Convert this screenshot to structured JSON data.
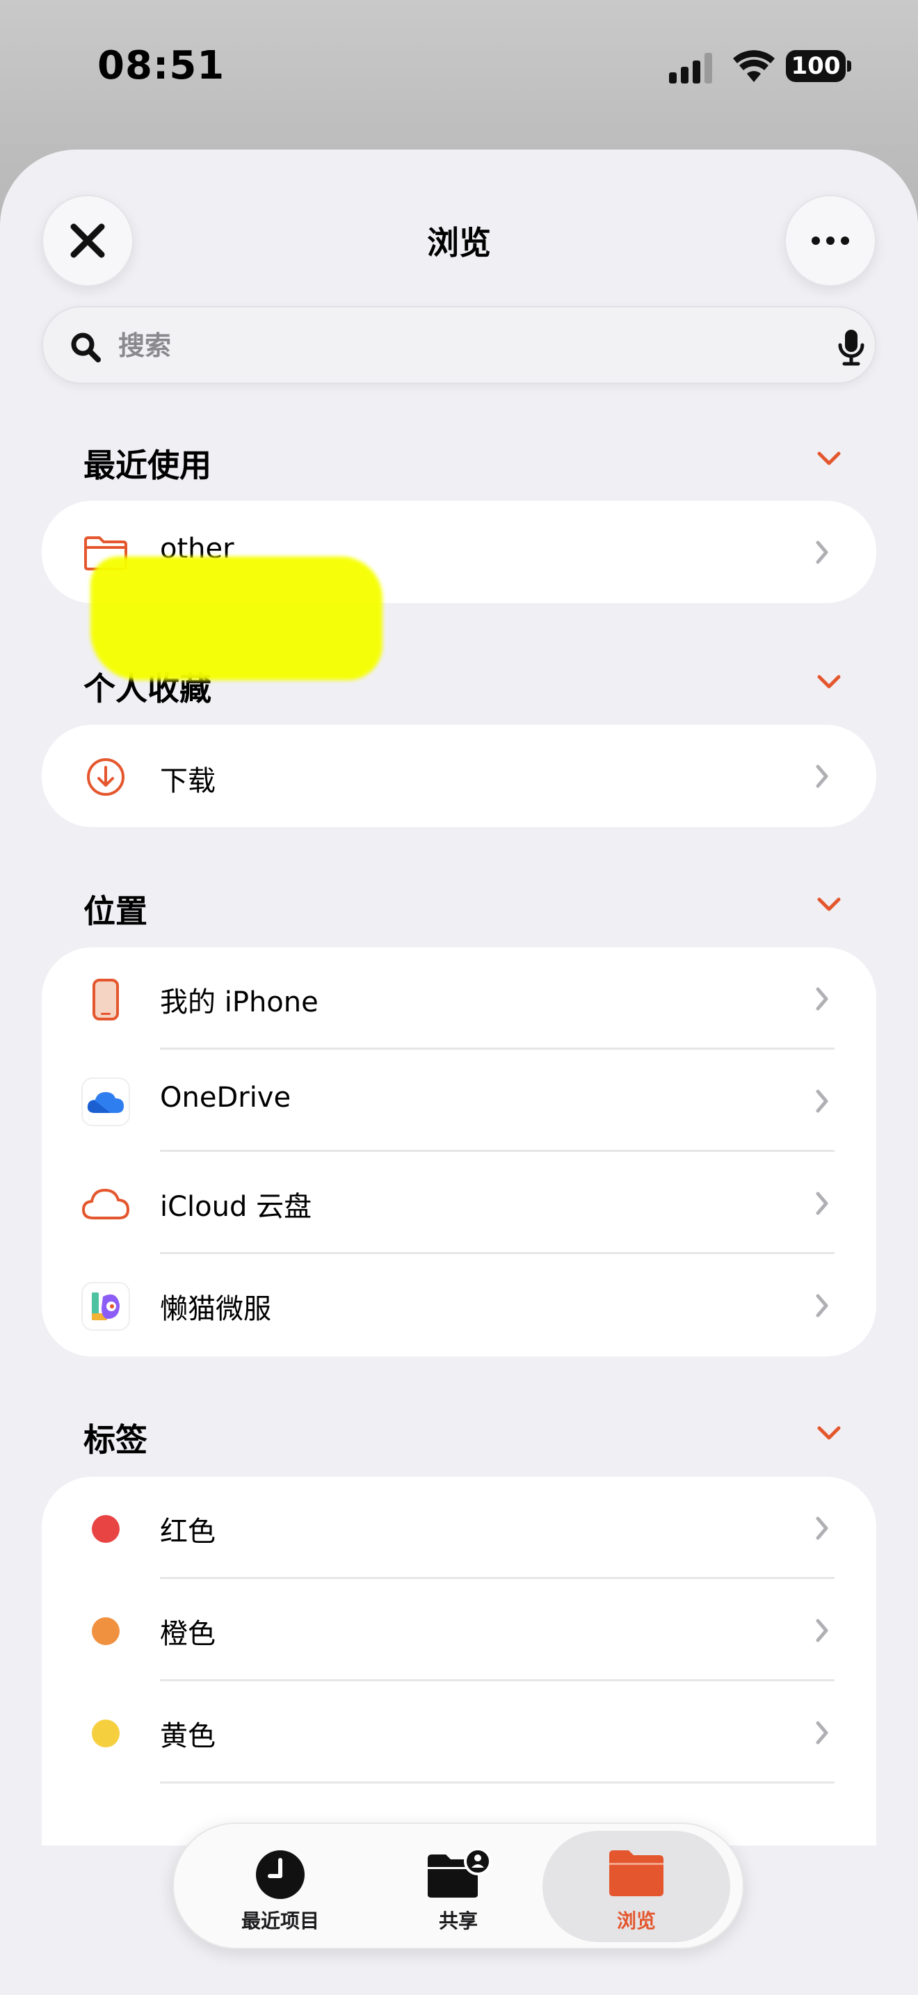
{
  "status_bar": {
    "time": "08:51",
    "battery": "100"
  },
  "header": {
    "title": "浏览"
  },
  "search": {
    "placeholder": "搜索"
  },
  "sections": {
    "recent": {
      "title": "最近使用",
      "items": [
        {
          "label": "other"
        }
      ]
    },
    "favorites": {
      "title": "个人收藏",
      "items": [
        {
          "label": "下载"
        }
      ]
    },
    "locations": {
      "title": "位置",
      "items": [
        {
          "label": "我的 iPhone"
        },
        {
          "label": "OneDrive"
        },
        {
          "label": "iCloud 云盘"
        },
        {
          "label": "懒猫微服"
        }
      ]
    },
    "tags": {
      "title": "标签",
      "items": [
        {
          "label": "红色",
          "color": "#e84444"
        },
        {
          "label": "橙色",
          "color": "#f0913f"
        },
        {
          "label": "黄色",
          "color": "#f6cf3f"
        }
      ]
    }
  },
  "tab_bar": {
    "tabs": [
      {
        "label": "最近项目"
      },
      {
        "label": "共享"
      },
      {
        "label": "浏览"
      }
    ],
    "active": "浏览"
  },
  "colors": {
    "accent": "#e4572e",
    "highlight": "#f6ff00"
  }
}
